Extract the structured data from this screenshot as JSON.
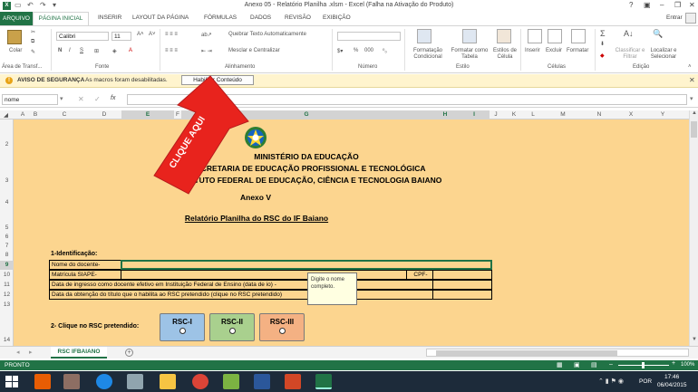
{
  "window": {
    "title": "Anexo 05 - Relatório Planilha .xlsm - Excel (Falha na Ativação do Produto)",
    "help": "?",
    "signin": "Entrar"
  },
  "tabs": [
    "ARQUIVO",
    "PÁGINA INICIAL",
    "INSERIR",
    "LAYOUT DA PÁGINA",
    "FÓRMULAS",
    "DADOS",
    "REVISÃO",
    "EXIBIÇÃO"
  ],
  "ribbon": {
    "clipboard": {
      "paste": "Colar",
      "label": "Área de Transf..."
    },
    "font": {
      "name": "Calibri",
      "size": "11",
      "label": "Fonte",
      "bold": "N",
      "italic": "I",
      "underline": "S"
    },
    "alignment": {
      "wrap": "Quebrar Texto Automaticamente",
      "merge": "Mesclar e Centralizar",
      "label": "Alinhamento"
    },
    "number": {
      "format": "",
      "label": "Número",
      "pct": "%",
      "thousands": "000"
    },
    "styles": {
      "conditional": "Formatação Condicional",
      "table": "Formatar como Tabela",
      "cell": "Estilos de Célula",
      "label": "Estilo"
    },
    "cells": {
      "insert": "Inserir",
      "delete": "Excluir",
      "format": "Formatar",
      "label": "Células"
    },
    "editing": {
      "sort": "Classificar e Filtrar",
      "find": "Localizar e Selecionar",
      "label": "Edição"
    }
  },
  "security": {
    "title": "AVISO DE SEGURANÇA",
    "message": "As macros foram desabilitadas.",
    "button": "Habilitar Conteúdo"
  },
  "formula_bar": {
    "name_box": "nome",
    "fx": "fx",
    "value": ""
  },
  "columns": [
    "A",
    "B",
    "C",
    "D",
    "E",
    "F",
    "G",
    "H",
    "I",
    "J",
    "K",
    "L",
    "M",
    "N",
    "X",
    "Y"
  ],
  "rows": [
    "2",
    "3",
    "4",
    "5",
    "6",
    "7",
    "8",
    "9",
    "10",
    "11",
    "12",
    "13",
    "14"
  ],
  "sheet": {
    "header1": "MINISTÉRIO DA EDUCAÇÃO",
    "header2": "SECRETARIA DE EDUCAÇÃO PROFISSIONAL E TECNOLÓGICA",
    "header3": "INSTITUTO FEDERAL DE EDUCAÇÃO, CIÊNCIA E TECNOLOGIA BAIANO",
    "annex": "Anexo V",
    "report_title": "Relatório Planilha do RSC do IF Baiano",
    "section1": "1-Identificação:",
    "field_name": "Nome do docente-",
    "field_siape": "Matrícula SIAPE-",
    "field_cpf": "CPF-",
    "field_ingresso": "Data de ingresso como docente efetivo em Instituição Federal de Ensino (data de                                    io) -",
    "field_titulo": "Data da obtenção do título que o habilita ao RSC pretendido (clique no RSC pretendido)",
    "tooltip": "Digite o nome completo.",
    "section2": "2- Clique no RSC pretendido:",
    "rsc_buttons": [
      {
        "label": "RSC-I",
        "color": "#9dc3e6"
      },
      {
        "label": "RSC-II",
        "color": "#a9d08e"
      },
      {
        "label": "RSC-III",
        "color": "#f4b183"
      }
    ]
  },
  "overlay": {
    "text": "CLIQUE AQUI",
    "color": "#e8231d"
  },
  "sheet_tab": "RSC IFBAIANO",
  "status": {
    "ready": "PRONTO",
    "zoom": "100%"
  },
  "taskbar": {
    "lang": "POR",
    "time": "17:46",
    "date": "06/04/2015"
  }
}
